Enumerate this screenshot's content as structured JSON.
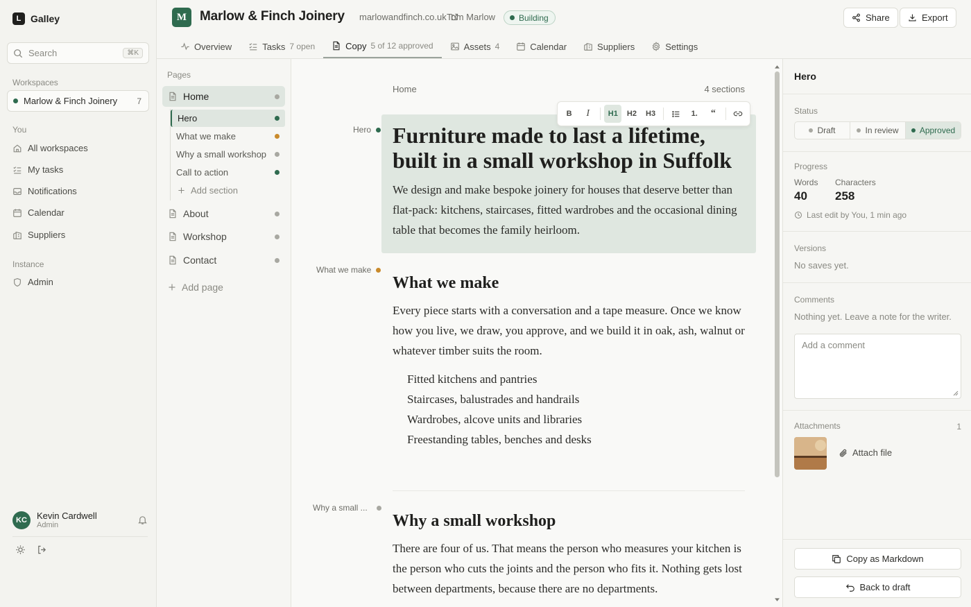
{
  "app": {
    "name": "Galley",
    "logo_letter": "L"
  },
  "sidebar": {
    "search_placeholder": "Search",
    "search_shortcut": "⌘K",
    "workspaces_label": "Workspaces",
    "workspace": {
      "name": "Marlow & Finch Joinery",
      "count": "7"
    },
    "you_label": "You",
    "you_items": [
      {
        "label": "All workspaces",
        "icon": "home-icon"
      },
      {
        "label": "My tasks",
        "icon": "tasks-icon"
      },
      {
        "label": "Notifications",
        "icon": "inbox-icon"
      },
      {
        "label": "Calendar",
        "icon": "calendar-icon"
      },
      {
        "label": "Suppliers",
        "icon": "building-icon"
      }
    ],
    "instance_label": "Instance",
    "instance_items": [
      {
        "label": "Admin",
        "icon": "shield-icon"
      }
    ],
    "user": {
      "initials": "KC",
      "name": "Kevin Cardwell",
      "role": "Admin"
    }
  },
  "header": {
    "logo_letter": "M",
    "title": "Marlow & Finch Joinery",
    "url": "marlowandfinch.co.uk",
    "owner": "Tom Marlow",
    "status": "Building",
    "share_label": "Share",
    "export_label": "Export",
    "tabs": [
      {
        "label": "Overview",
        "sub": ""
      },
      {
        "label": "Tasks",
        "sub": "7 open"
      },
      {
        "label": "Copy",
        "sub": "5 of 12 approved"
      },
      {
        "label": "Assets",
        "sub": "4"
      },
      {
        "label": "Calendar",
        "sub": ""
      },
      {
        "label": "Suppliers",
        "sub": ""
      },
      {
        "label": "Settings",
        "sub": ""
      }
    ]
  },
  "pages": {
    "label": "Pages",
    "home": "Home",
    "sections": [
      "Hero",
      "What we make",
      "Why a small workshop",
      "Call to action"
    ],
    "add_section": "Add section",
    "others": [
      "About",
      "Workshop",
      "Contact"
    ],
    "add_page": "Add page"
  },
  "editor": {
    "breadcrumb": "Home",
    "sections_count": "4 sections",
    "toolbar": {
      "bold": "B",
      "italic": "I",
      "h1": "H1",
      "h2": "H2",
      "h3": "H3",
      "ordered": "1.",
      "quote": "“"
    },
    "hero": {
      "label": "Hero",
      "heading_line1": "Furniture made to last a lifetime,",
      "heading_line2": "built in a small workshop in Suffolk",
      "body": "We design and make bespoke joinery for houses that deserve better than flat-pack: kitchens, staircases, fitted wardrobes and the occasional dining table that becomes the family heirloom."
    },
    "what": {
      "label": "What we make",
      "heading": "What we make",
      "body": "Every piece starts with a conversation and a tape measure. Once we know how you live, we draw, you approve, and we build it in oak, ash, walnut or whatever timber suits the room.",
      "list": [
        "Fitted kitchens and pantries",
        "Staircases, balustrades and handrails",
        "Wardrobes, alcove units and libraries",
        "Freestanding tables, benches and desks"
      ]
    },
    "why": {
      "label": "Why a small ...",
      "heading": "Why a small workshop",
      "body": "There are four of us. That means the person who measures your kitchen is the person who cuts the joints and the person who fits it. Nothing gets lost between departments, because there are no departments."
    }
  },
  "panel": {
    "title": "Hero",
    "status_label": "Status",
    "status_options": [
      "Draft",
      "In review",
      "Approved"
    ],
    "progress_label": "Progress",
    "words_label": "Words",
    "words": "40",
    "chars_label": "Characters",
    "chars": "258",
    "last_edit": "Last edit by You, 1 min ago",
    "versions_label": "Versions",
    "versions_text": "No saves yet.",
    "comments_label": "Comments",
    "comments_text": "Nothing yet. Leave a note for the writer.",
    "comment_placeholder": "Add a comment",
    "attachments_label": "Attachments",
    "attachments_count": "1",
    "attach_label": "Attach file",
    "copy_md": "Copy as Markdown",
    "back_draft": "Back to draft"
  },
  "colors": {
    "accent": "#2f6b4f",
    "highlight": "#dfe7e0",
    "amber": "#c98a2b"
  }
}
